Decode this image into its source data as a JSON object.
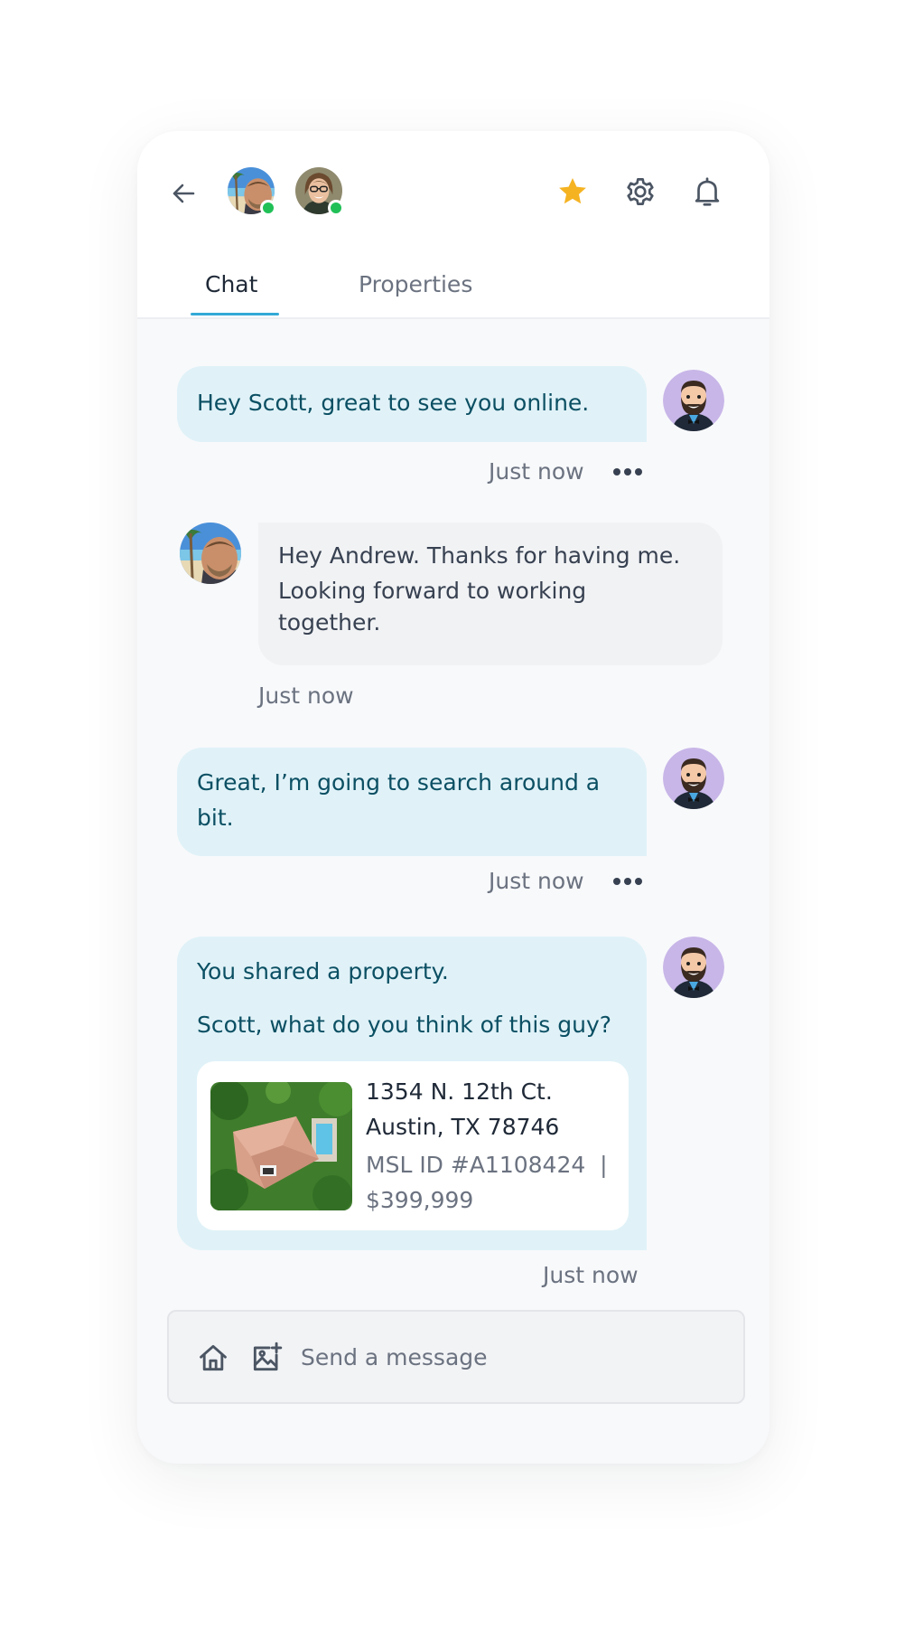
{
  "header": {
    "participants": [
      {
        "name": "participant-scott",
        "online": true
      },
      {
        "name": "participant-andrew",
        "online": true
      }
    ],
    "icons": [
      "back-arrow-icon",
      "star-icon",
      "gear-icon",
      "bell-icon"
    ],
    "accent_color": "#f5b322"
  },
  "tabs": [
    {
      "label": "Chat",
      "active": true
    },
    {
      "label": "Properties",
      "active": false
    }
  ],
  "messages": [
    {
      "text": "Hey Scott, great to see you online.",
      "time": "Just now",
      "direction": "outgoing"
    },
    {
      "line1": "Hey Andrew. Thanks for having me.",
      "line2": "Looking forward to working",
      "line3": "together.",
      "time": "Just now",
      "direction": "incoming"
    },
    {
      "line1": "Great, I’m going to search around a",
      "line2": "bit.",
      "time": "Just now",
      "direction": "outgoing"
    },
    {
      "text": "You shared a property.",
      "text2": "Scott, what do you think of this guy?",
      "time": "Just now",
      "direction": "outgoing",
      "property": {
        "address1": "1354 N. 12th Ct.",
        "address2": "Austin, TX 78746",
        "mls": "MSL ID #A1108424  |",
        "price": "$399,999"
      }
    }
  ],
  "composer": {
    "placeholder": "Send a message",
    "icons": [
      "home-icon",
      "add-image-icon"
    ]
  },
  "colors": {
    "outgoing_bubble": "#e0f2f8",
    "incoming_bubble": "#f1f2f4",
    "tab_underline": "#33a9d6",
    "online": "#20c057"
  }
}
